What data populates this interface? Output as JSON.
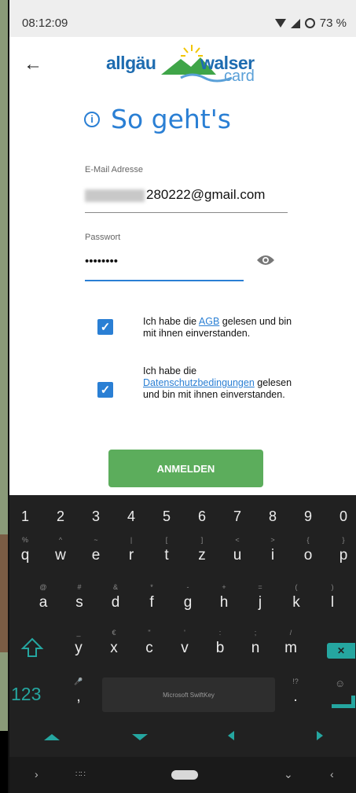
{
  "status_bar": {
    "time": "08:12:09",
    "battery": "73 %"
  },
  "app_bar": {
    "logo_word_left": "allgäu",
    "logo_word_right": "walser",
    "logo_word_sub": "card",
    "back_icon": "arrow-left-icon"
  },
  "help": {
    "title": "So geht's",
    "icon": "info-icon"
  },
  "form": {
    "email_label": "E-Mail Adresse",
    "email_value_visible": "280222@gmail.com",
    "password_label": "Passwort",
    "password_value": "••••••••",
    "agb_text_pre": "Ich habe die ",
    "agb_link": "AGB",
    "agb_text_post": " gelesen und bin mit ihnen einverstanden.",
    "agb_checked": true,
    "privacy_text_pre": "Ich habe die ",
    "privacy_link": "Datenschutzbedingungen",
    "privacy_text_post": " gelesen und bin mit ihnen einverstanden.",
    "privacy_checked": true,
    "login_label": "ANMELDEN"
  },
  "keyboard": {
    "number_row": [
      "1",
      "2",
      "3",
      "4",
      "5",
      "6",
      "7",
      "8",
      "9",
      "0"
    ],
    "row1": [
      [
        "q",
        "%"
      ],
      [
        "w",
        "^"
      ],
      [
        "e",
        "~"
      ],
      [
        "r",
        "|"
      ],
      [
        "t",
        "["
      ],
      [
        "z",
        "]"
      ],
      [
        "u",
        "<"
      ],
      [
        "i",
        ">"
      ],
      [
        "o",
        "{"
      ],
      [
        "p",
        "}"
      ]
    ],
    "row2": [
      [
        "a",
        "@"
      ],
      [
        "s",
        "#"
      ],
      [
        "d",
        "&"
      ],
      [
        "f",
        "*"
      ],
      [
        "g",
        "-"
      ],
      [
        "h",
        "+"
      ],
      [
        "j",
        "="
      ],
      [
        "k",
        "("
      ],
      [
        "l",
        ")"
      ]
    ],
    "row3": [
      [
        "y",
        "_"
      ],
      [
        "x",
        "€"
      ],
      [
        "c",
        "\""
      ],
      [
        "v",
        "'"
      ],
      [
        "b",
        ":"
      ],
      [
        "n",
        ";"
      ],
      [
        "m",
        "/"
      ]
    ],
    "numbers_key": "123",
    "space_label": "Microsoft SwiftKey",
    "comma": ",",
    "period": ".",
    "hint_period": "!?",
    "accent": "#25a6a0"
  },
  "colors": {
    "primary": "#2a7fd4",
    "button": "#5cad5c"
  }
}
